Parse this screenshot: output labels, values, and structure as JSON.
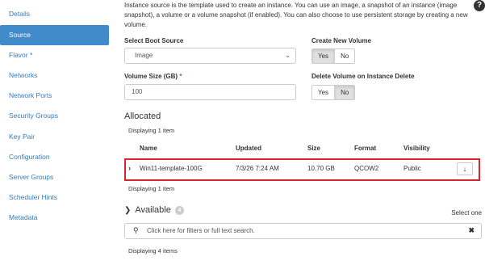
{
  "sidebar": {
    "items": [
      {
        "label": "Details"
      },
      {
        "label": "Source"
      },
      {
        "label": "Flavor",
        "required": "*"
      },
      {
        "label": "Networks"
      },
      {
        "label": "Network Ports"
      },
      {
        "label": "Security Groups"
      },
      {
        "label": "Key Pair"
      },
      {
        "label": "Configuration"
      },
      {
        "label": "Server Groups"
      },
      {
        "label": "Scheduler Hints"
      },
      {
        "label": "Metadata"
      }
    ],
    "active_index": 1
  },
  "help_icon": "?",
  "intro": "Instance source is the template used to create an instance. You can use an image, a snapshot of an instance (image snapshot), a volume or a volume snapshot (if enabled). You can also choose to use persistent storage by creating a new volume.",
  "boot_source": {
    "label": "Select Boot Source",
    "value": "Image"
  },
  "create_volume": {
    "label": "Create New Volume",
    "yes": "Yes",
    "no": "No",
    "selected": "Yes"
  },
  "volume_size": {
    "label": "Volume Size (GB)",
    "required": "*",
    "value": "100"
  },
  "delete_volume": {
    "label": "Delete Volume on Instance Delete",
    "yes": "Yes",
    "no": "No",
    "selected": "No"
  },
  "allocated": {
    "title": "Allocated",
    "displaying_top": "Displaying 1 item",
    "displaying_bottom": "Displaying 1 item",
    "columns": {
      "name": "Name",
      "updated": "Updated",
      "size": "Size",
      "format": "Format",
      "visibility": "Visibility"
    },
    "row": {
      "toggle": "›",
      "name": "Win11-template-100G",
      "updated": "7/3/26 7:24 AM",
      "size": "10.70 GB",
      "format": "QCOW2",
      "visibility": "Public",
      "action": "↓"
    }
  },
  "available": {
    "title": "Available",
    "count": "4",
    "select_one": "Select one",
    "search_placeholder": "Click here for filters or full text search.",
    "displaying": "Displaying 4 items"
  },
  "colors": {
    "accent": "#428bca",
    "link": "#337ab7",
    "highlight_border": "#d9232e"
  }
}
